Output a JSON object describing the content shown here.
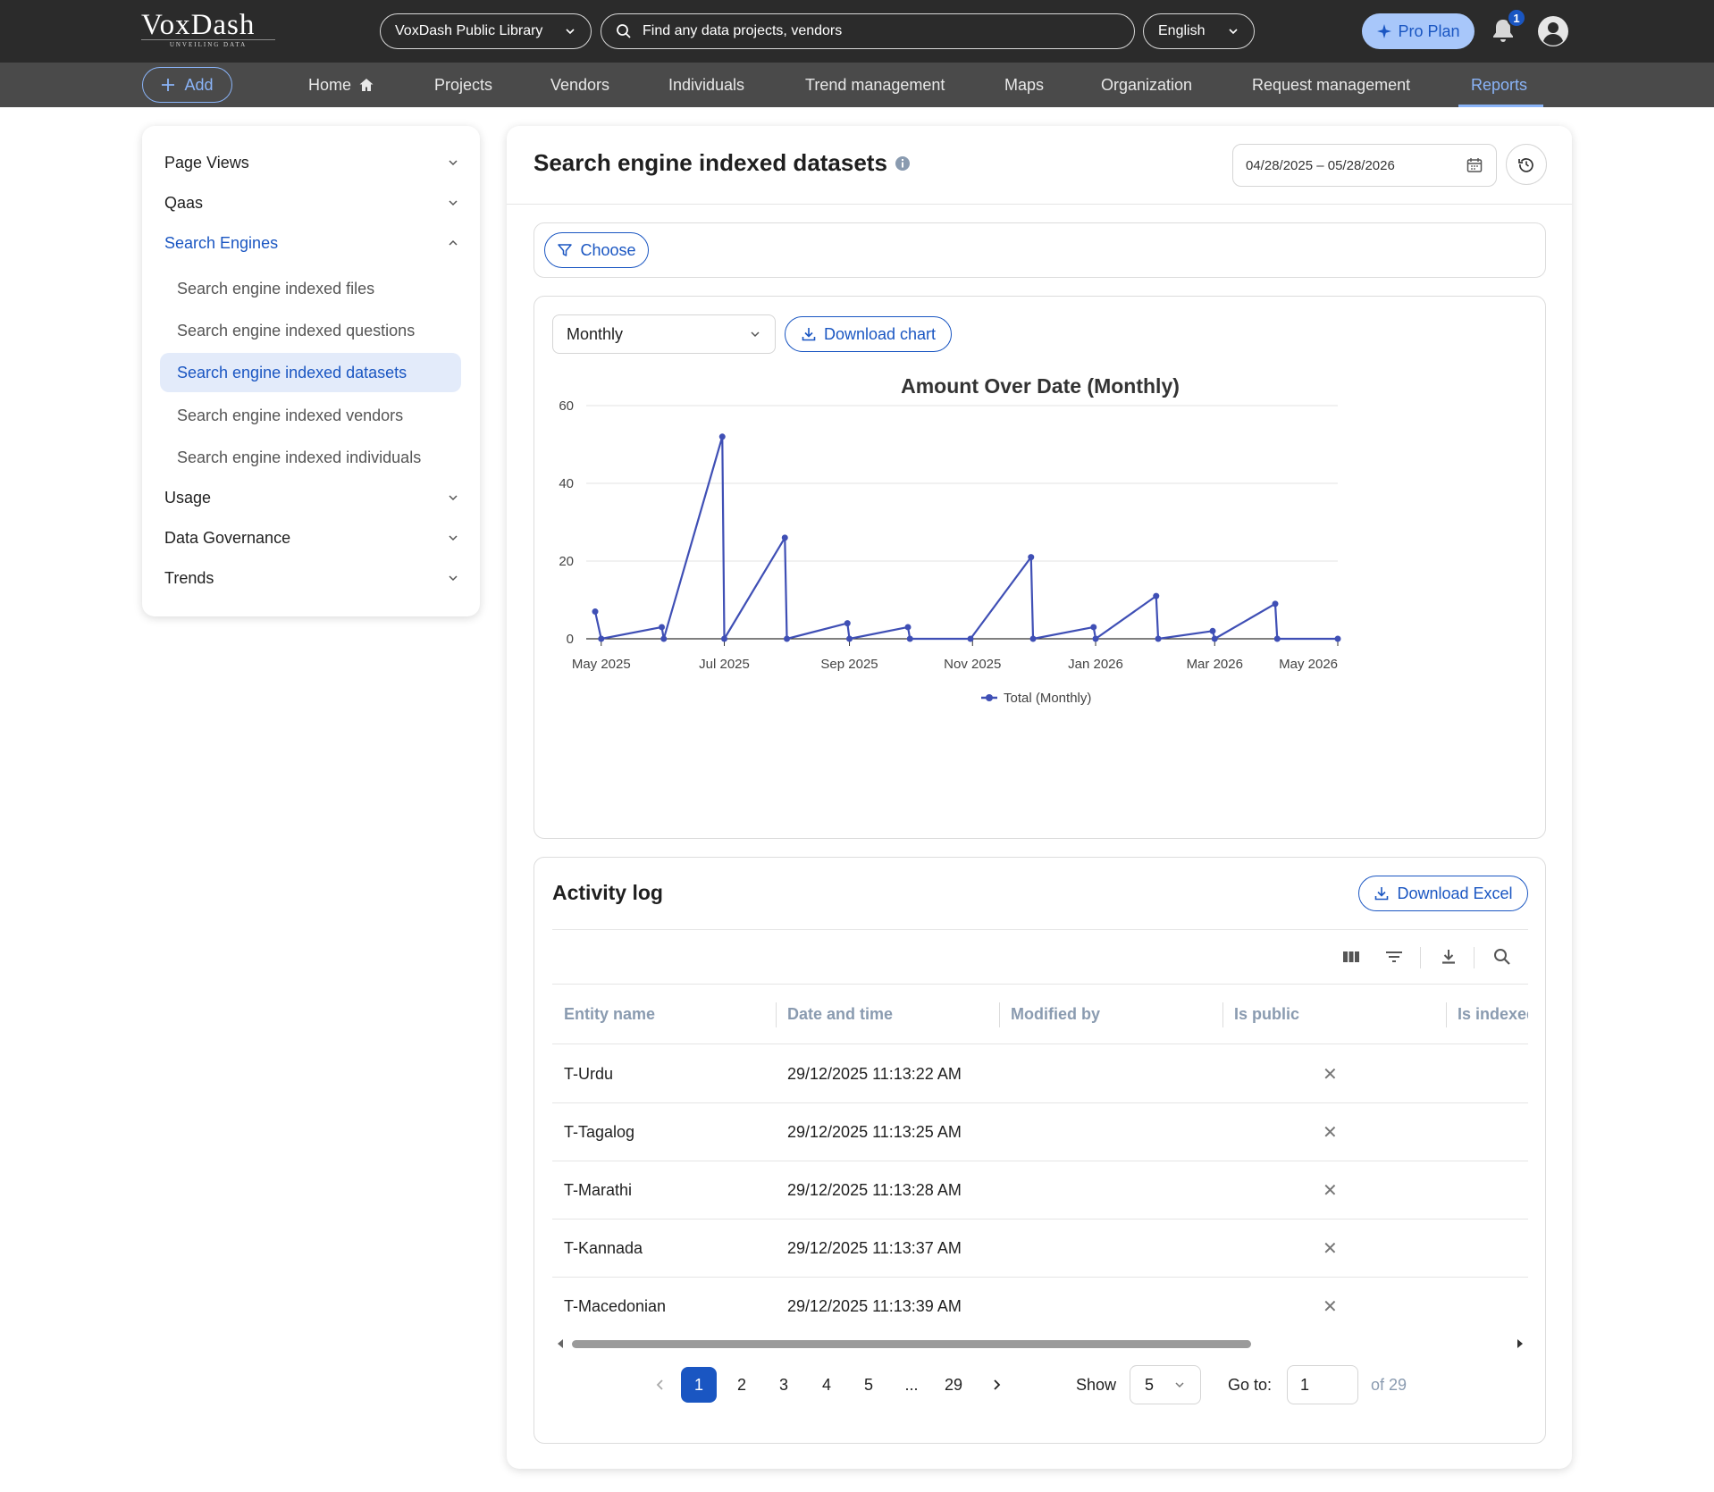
{
  "brand": {
    "name": "VoxDash",
    "tagline": "UNVEILING DATA"
  },
  "header": {
    "library": "VoxDash Public Library",
    "search_placeholder": "Find any data projects, vendors",
    "language": "English",
    "pro_label": "Pro Plan",
    "notification_count": "1"
  },
  "nav": {
    "add_label": "Add",
    "items": [
      "Home",
      "Projects",
      "Vendors",
      "Individuals",
      "Trend management",
      "Maps",
      "Organization",
      "Request management",
      "Reports"
    ],
    "active": "Reports"
  },
  "sidebar": {
    "groups": [
      {
        "label": "Page Views",
        "expanded": false
      },
      {
        "label": "Qaas",
        "expanded": false
      },
      {
        "label": "Search Engines",
        "expanded": true
      },
      {
        "label": "Usage",
        "expanded": false
      },
      {
        "label": "Data Governance",
        "expanded": false
      },
      {
        "label": "Trends",
        "expanded": false
      }
    ],
    "sub_items": [
      "Search engine indexed files",
      "Search engine indexed questions",
      "Search engine indexed datasets",
      "Search engine indexed vendors",
      "Search engine indexed individuals"
    ],
    "active_sub": "Search engine indexed datasets"
  },
  "main": {
    "title": "Search engine indexed datasets",
    "date_range": "04/28/2025 – 05/28/2026",
    "choose_label": "Choose",
    "period": "Monthly",
    "download_chart_label": "Download chart"
  },
  "chart_data": {
    "type": "line",
    "title": "Amount Over Date (Monthly)",
    "xlabel": "",
    "ylabel": "",
    "ylim": [
      0,
      60
    ],
    "yticks": [
      0,
      20,
      40,
      60
    ],
    "xticks": [
      "May 2025",
      "Jul 2025",
      "Sep 2025",
      "Nov 2025",
      "Jan 2026",
      "Mar 2026",
      "May 2026"
    ],
    "grid": true,
    "legend_position": "bottom",
    "series": [
      {
        "name": "Total (Monthly)",
        "color": "#3f4fb5",
        "points": [
          {
            "x": "2025-04-28",
            "y": 7
          },
          {
            "x": "2025-05-01",
            "y": 0
          },
          {
            "x": "2025-05-31",
            "y": 3
          },
          {
            "x": "2025-06-01",
            "y": 0
          },
          {
            "x": "2025-06-30",
            "y": 52
          },
          {
            "x": "2025-07-01",
            "y": 0
          },
          {
            "x": "2025-07-31",
            "y": 26
          },
          {
            "x": "2025-08-01",
            "y": 0
          },
          {
            "x": "2025-08-31",
            "y": 4
          },
          {
            "x": "2025-09-01",
            "y": 0
          },
          {
            "x": "2025-09-30",
            "y": 3
          },
          {
            "x": "2025-10-01",
            "y": 0
          },
          {
            "x": "2025-10-31",
            "y": 0
          },
          {
            "x": "2025-11-30",
            "y": 21
          },
          {
            "x": "2025-12-01",
            "y": 0
          },
          {
            "x": "2025-12-31",
            "y": 3
          },
          {
            "x": "2026-01-01",
            "y": 0
          },
          {
            "x": "2026-01-31",
            "y": 11
          },
          {
            "x": "2026-02-01",
            "y": 0
          },
          {
            "x": "2026-02-28",
            "y": 2
          },
          {
            "x": "2026-03-01",
            "y": 0
          },
          {
            "x": "2026-03-31",
            "y": 9
          },
          {
            "x": "2026-04-01",
            "y": 0
          },
          {
            "x": "2026-05-01",
            "y": 0
          }
        ]
      }
    ]
  },
  "activity": {
    "title": "Activity log",
    "download_excel_label": "Download Excel",
    "columns": [
      "Entity name",
      "Date and time",
      "Modified by",
      "Is public",
      "Is indexed"
    ],
    "rows": [
      {
        "entity": "T-Urdu",
        "date": "29/12/2025 11:13:22 AM",
        "modified_by": "",
        "is_public": "✕"
      },
      {
        "entity": "T-Tagalog",
        "date": "29/12/2025 11:13:25 AM",
        "modified_by": "",
        "is_public": "✕"
      },
      {
        "entity": "T-Marathi",
        "date": "29/12/2025 11:13:28 AM",
        "modified_by": "",
        "is_public": "✕"
      },
      {
        "entity": "T-Kannada",
        "date": "29/12/2025 11:13:37 AM",
        "modified_by": "",
        "is_public": "✕"
      },
      {
        "entity": "T-Macedonian",
        "date": "29/12/2025 11:13:39 AM",
        "modified_by": "",
        "is_public": "✕"
      }
    ]
  },
  "pagination": {
    "pages": [
      "1",
      "2",
      "3",
      "4",
      "5",
      "...",
      "29"
    ],
    "current": "1",
    "show_label": "Show",
    "page_size": "5",
    "goto_label": "Go to:",
    "goto_value": "1",
    "total_label": "of 29"
  }
}
